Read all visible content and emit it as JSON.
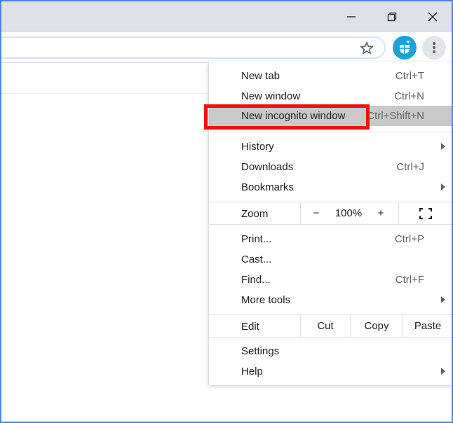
{
  "window": {
    "minimize_glyph": "—",
    "accent_frame": "#4a86e8"
  },
  "toolbar": {
    "star_icon": "star-outline",
    "profile_icon": "profile-avatar",
    "menu_icon": "three-dots-vertical"
  },
  "menu": {
    "new_tab": {
      "label": "New tab",
      "shortcut": "Ctrl+T"
    },
    "new_window": {
      "label": "New window",
      "shortcut": "Ctrl+N"
    },
    "new_incognito": {
      "label": "New incognito window",
      "shortcut": "Ctrl+Shift+N"
    },
    "history": {
      "label": "History"
    },
    "downloads": {
      "label": "Downloads",
      "shortcut": "Ctrl+J"
    },
    "bookmarks": {
      "label": "Bookmarks"
    },
    "zoom": {
      "label": "Zoom",
      "minus": "−",
      "value": "100%",
      "plus": "+"
    },
    "print": {
      "label": "Print...",
      "shortcut": "Ctrl+P"
    },
    "cast": {
      "label": "Cast..."
    },
    "find": {
      "label": "Find...",
      "shortcut": "Ctrl+F"
    },
    "more_tools": {
      "label": "More tools"
    },
    "edit": {
      "label": "Edit",
      "cut": "Cut",
      "copy": "Copy",
      "paste": "Paste"
    },
    "settings": {
      "label": "Settings"
    },
    "help": {
      "label": "Help"
    }
  },
  "highlight": {
    "color": "#ee1111",
    "target": "new_incognito"
  }
}
